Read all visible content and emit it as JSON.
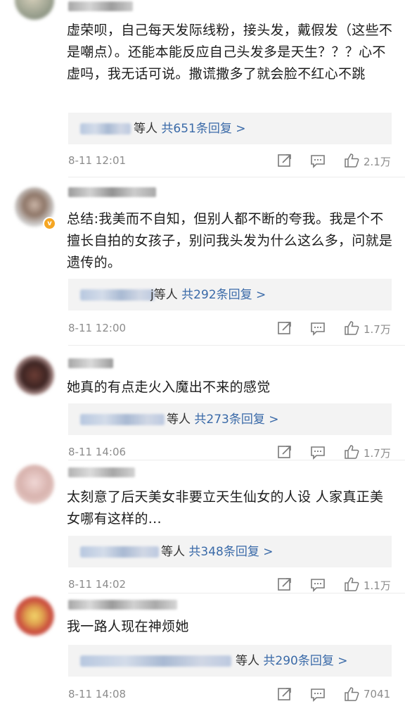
{
  "comments": [
    {
      "text": "虚荣呗，自己每天发际线粉，接头发，戴假发（这些不是嘲点）。还能本能反应自己头发多是天生？？？心不虚吗，我无话可说。撒谎撒多了就会脸不红心不跳",
      "reply_suffix": "等人",
      "reply_count": "共651条回复 >",
      "time": "8-11 12:01",
      "likes": "2.1万"
    },
    {
      "text": "总结:我美而不自知，但别人都不断的夸我。我是个不擅长自拍的女孩子，别问我头发为什么这么多，问就是遗传的。",
      "reply_suffix": "j等人",
      "reply_count": "共292条回复 >",
      "time": "8-11 12:00",
      "likes": "1.7万"
    },
    {
      "text": "她真的有点走火入魔出不来的感觉",
      "reply_suffix": "等人",
      "reply_count": "共273条回复 >",
      "time": "8-11 14:06",
      "likes": "1.7万"
    },
    {
      "text": "太刻意了后天美女非要立天生仙女的人设 人家真正美女哪有这样的...",
      "reply_suffix": "等人",
      "reply_count": "共348条回复 >",
      "time": "8-11 14:02",
      "likes": "1.1万"
    },
    {
      "text": "我一路人现在神烦她",
      "reply_suffix": "等人",
      "reply_count": "共290条回复 >",
      "time": "8-11 14:08",
      "likes": "7041"
    }
  ],
  "icons": {
    "share": "share-icon",
    "comment": "comment-icon",
    "like": "thumbs-up-icon",
    "verified": "verified-badge-icon"
  },
  "colors": {
    "reply_link": "#3a6aa8",
    "meta_text": "#8c8c8c",
    "reply_bg": "#f3f3f3",
    "verified": "#f5a623"
  }
}
